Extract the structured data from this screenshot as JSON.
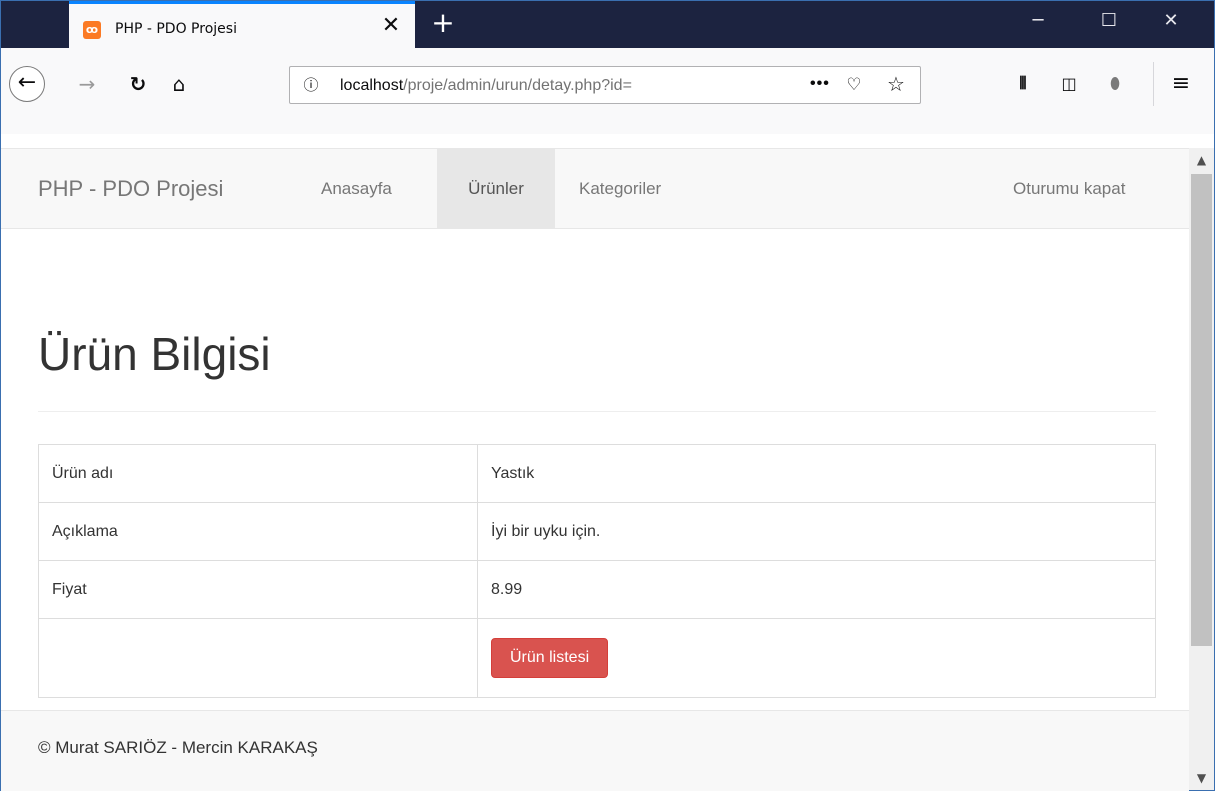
{
  "browser": {
    "tab_title": "PHP - PDO Projesi",
    "tab_favicon": "xampp-icon",
    "close_glyph": "✕",
    "new_tab_glyph": "+",
    "url_host": "localhost",
    "url_path": "/proje/admin/urun/detay.php?id=",
    "url_more": "•••",
    "icons": [
      "back-icon",
      "forward-icon",
      "reload-icon",
      "home-icon",
      "info-icon",
      "pocket-icon",
      "star-icon",
      "library-icon",
      "sidebar-icon",
      "shield-icon",
      "menu-icon"
    ],
    "accent_color": "#0a84ff",
    "titlebar_color": "#1c2340"
  },
  "navbar": {
    "brand": "PHP - PDO Projesi",
    "items": [
      {
        "label": "Anasayfa",
        "active": false
      },
      {
        "label": "Ürünler",
        "active": true
      },
      {
        "label": "Kategoriler",
        "active": false
      }
    ],
    "logout_label": "Oturumu kapat"
  },
  "page": {
    "title": "Ürün Bilgisi"
  },
  "product_table": {
    "rows": [
      {
        "label": "Ürün adı",
        "value": "Yastık"
      },
      {
        "label": "Açıklama",
        "value": "İyi bir uyku için."
      },
      {
        "label": "Fiyat",
        "value": "8.99"
      }
    ],
    "button_label": "Ürün listesi",
    "button_color": "#d9534f"
  },
  "footer": {
    "text": "© Murat SARIÖZ - Mercin KARAKAŞ"
  }
}
